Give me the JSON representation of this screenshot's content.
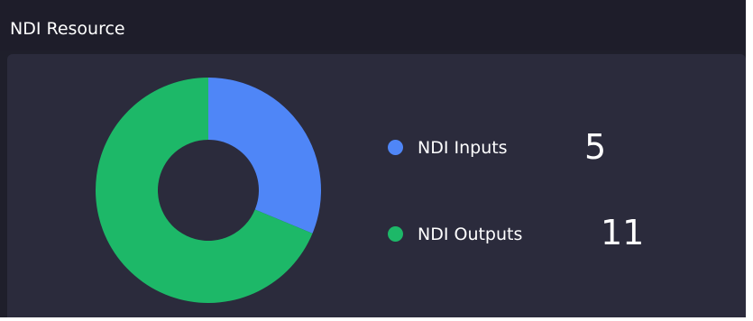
{
  "header": {
    "title": "NDI Resource"
  },
  "colors": {
    "inputs": "#4f86f7",
    "outputs": "#1db868",
    "panel": "#2b2b3c",
    "header": "#1e1d2a"
  },
  "legend": {
    "items": [
      {
        "label": "NDI Inputs",
        "value": "5",
        "color_key": "inputs"
      },
      {
        "label": "NDI Outputs",
        "value": "11",
        "color_key": "outputs"
      }
    ]
  },
  "chart_data": {
    "type": "pie",
    "donut": true,
    "categories": [
      "NDI Inputs",
      "NDI Outputs"
    ],
    "values": [
      5,
      11
    ],
    "colors": [
      "#4f86f7",
      "#1db868"
    ]
  }
}
